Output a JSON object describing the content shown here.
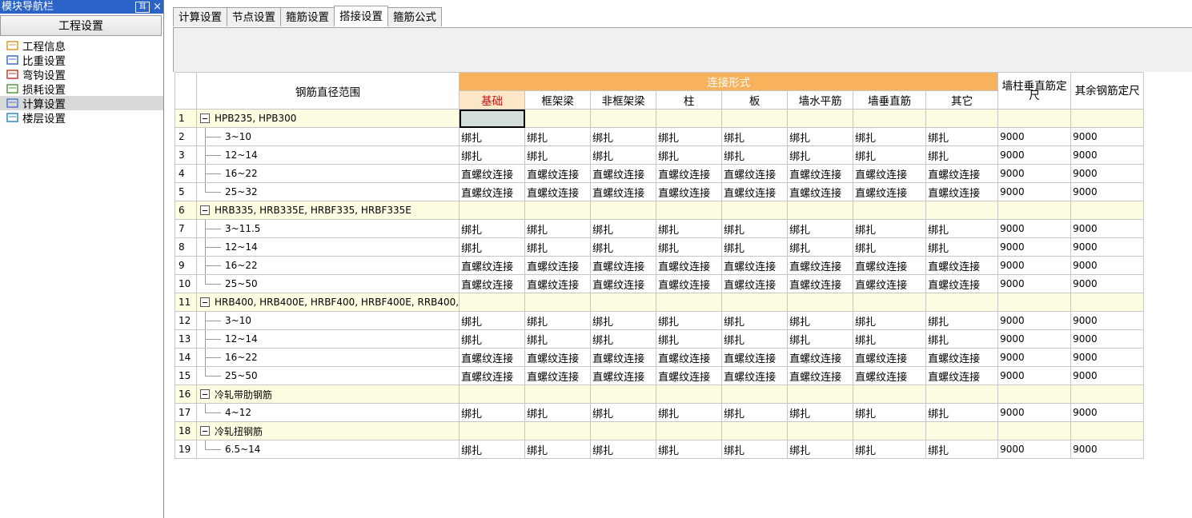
{
  "nav": {
    "title": "模块导航栏",
    "pin_label": "耳",
    "close_label": "×",
    "section": "工程设置",
    "items": [
      {
        "label": "工程信息",
        "icon": "project-info-icon"
      },
      {
        "label": "比重设置",
        "icon": "density-icon"
      },
      {
        "label": "弯钩设置",
        "icon": "hook-icon"
      },
      {
        "label": "损耗设置",
        "icon": "loss-icon"
      },
      {
        "label": "计算设置",
        "icon": "calc-settings-icon"
      },
      {
        "label": "楼层设置",
        "icon": "floor-settings-icon"
      }
    ]
  },
  "tabs": [
    "计算设置",
    "节点设置",
    "箍筋设置",
    "搭接设置",
    "箍筋公式"
  ],
  "active_tab": 3,
  "grid": {
    "range_header": "钢筋直径范围",
    "group_header": "连接形式",
    "columns": [
      "基础",
      "框架梁",
      "非框架梁",
      "柱",
      "板",
      "墙水平筋",
      "墙垂直筋",
      "其它"
    ],
    "wall_length_header": "墙柱垂直筋定尺",
    "other_length_header": "其余钢筋定尺",
    "rows": [
      {
        "n": "1",
        "group": true,
        "name": "HPB235, HPB300"
      },
      {
        "n": "2",
        "name": "3~10",
        "type": "tie",
        "a": "9000",
        "b": "9000"
      },
      {
        "n": "3",
        "name": "12~14",
        "type": "tie",
        "a": "9000",
        "b": "9000"
      },
      {
        "n": "4",
        "name": "16~22",
        "type": "screw",
        "a": "9000",
        "b": "9000"
      },
      {
        "n": "5",
        "name": "25~32",
        "type": "screw",
        "a": "9000",
        "b": "9000",
        "last": true
      },
      {
        "n": "6",
        "group": true,
        "name": "HRB335, HRB335E, HRBF335, HRBF335E"
      },
      {
        "n": "7",
        "name": "3~11.5",
        "type": "tie",
        "a": "9000",
        "b": "9000"
      },
      {
        "n": "8",
        "name": "12~14",
        "type": "tie",
        "a": "9000",
        "b": "9000"
      },
      {
        "n": "9",
        "name": "16~22",
        "type": "screw",
        "a": "9000",
        "b": "9000"
      },
      {
        "n": "10",
        "name": "25~50",
        "type": "screw",
        "a": "9000",
        "b": "9000",
        "last": true
      },
      {
        "n": "11",
        "group": true,
        "name": "HRB400, HRB400E, HRBF400, HRBF400E, RRB400,"
      },
      {
        "n": "12",
        "name": "3~10",
        "type": "tie",
        "a": "9000",
        "b": "9000"
      },
      {
        "n": "13",
        "name": "12~14",
        "type": "tie",
        "a": "9000",
        "b": "9000"
      },
      {
        "n": "14",
        "name": "16~22",
        "type": "screw",
        "a": "9000",
        "b": "9000"
      },
      {
        "n": "15",
        "name": "25~50",
        "type": "screw",
        "a": "9000",
        "b": "9000",
        "last": true
      },
      {
        "n": "16",
        "group": true,
        "name": "冷轧带肋钢筋"
      },
      {
        "n": "17",
        "name": "4~12",
        "type": "tie",
        "a": "9000",
        "b": "9000",
        "last": true
      },
      {
        "n": "18",
        "group": true,
        "name": "冷轧扭钢筋"
      },
      {
        "n": "19",
        "name": "6.5~14",
        "type": "tie",
        "a": "9000",
        "b": "9000",
        "last": true
      }
    ],
    "tie_label": "绑扎",
    "screw_label": "直螺纹连接"
  },
  "colors": {
    "nav_header": "#2b63c9",
    "group_row": "#fffde1",
    "header_orange": "#f7b25b",
    "base_text": "#c41212"
  }
}
